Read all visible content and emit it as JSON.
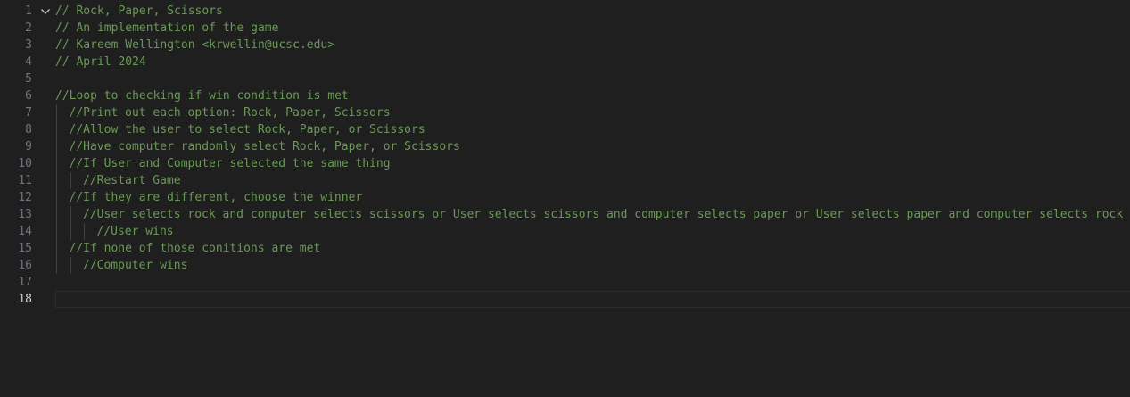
{
  "editor": {
    "active_line": 18,
    "lines": [
      {
        "num": "1",
        "text": "// Rock, Paper, Scissors",
        "indent": 0,
        "fold": true
      },
      {
        "num": "2",
        "text": "// An implementation of the game",
        "indent": 0
      },
      {
        "num": "3",
        "text": "// Kareem Wellington <krwellin@ucsc.edu>",
        "indent": 0
      },
      {
        "num": "4",
        "text": "// April 2024",
        "indent": 0
      },
      {
        "num": "5",
        "text": "",
        "indent": 0
      },
      {
        "num": "6",
        "text": "//Loop to checking if win condition is met",
        "indent": 0
      },
      {
        "num": "7",
        "text": "//Print out each option: Rock, Paper, Scissors",
        "indent": 1
      },
      {
        "num": "8",
        "text": "//Allow the user to select Rock, Paper, or Scissors",
        "indent": 1
      },
      {
        "num": "9",
        "text": "//Have computer randomly select Rock, Paper, or Scissors",
        "indent": 1
      },
      {
        "num": "10",
        "text": "//If User and Computer selected the same thing",
        "indent": 1
      },
      {
        "num": "11",
        "text": "//Restart Game",
        "indent": 2
      },
      {
        "num": "12",
        "text": "//If they are different, choose the winner",
        "indent": 1
      },
      {
        "num": "13",
        "text": "//User selects rock and computer selects scissors or User selects scissors and computer selects paper or User selects paper and computer selects rock",
        "indent": 2
      },
      {
        "num": "14",
        "text": "//User wins",
        "indent": 3
      },
      {
        "num": "15",
        "text": "//If none of those conitions are met",
        "indent": 1
      },
      {
        "num": "16",
        "text": "//Computer wins",
        "indent": 2
      },
      {
        "num": "17",
        "text": "",
        "indent": 0
      },
      {
        "num": "18",
        "text": "",
        "indent": 0
      }
    ]
  }
}
